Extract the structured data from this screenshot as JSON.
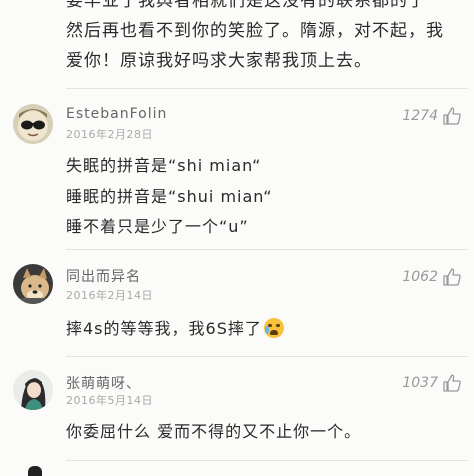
{
  "top_text": {
    "lines": [
      "要毕业了我舆者相就们是这没有的联系都的了",
      "然后再也看不到你的笑脸了。隋源，对不起，我",
      "爱你！原谅我好吗求大家帮我顶上去。"
    ]
  },
  "comments": [
    {
      "username": "EstebanFolin",
      "date": "2016年2月28日",
      "likes": "1274",
      "avatar_icon": "sunglasses-face-avatar",
      "lines": [
        "失眠的拼音是“shi   mian“",
        "睡眠的拼音是“shui mian“",
        "睡不着只是少了一个“u”"
      ]
    },
    {
      "username": "同出而异名",
      "date": "2016年2月14日",
      "likes": "1062",
      "avatar_icon": "doge-avatar",
      "lines": [
        "摔4s的等等我，我6S摔了"
      ],
      "emoji_icon": "crying-face-emoji"
    },
    {
      "username": "张萌萌呀、",
      "date": "2016年5月14日",
      "likes": "1037",
      "avatar_icon": "girl-avatar",
      "lines": [
        "你委屈什么  爱而不得的又不止你一个。"
      ]
    }
  ],
  "colors": {
    "background": "#fbfbf9",
    "meta": "#a9a9a9",
    "text": "#2a2a2a"
  }
}
